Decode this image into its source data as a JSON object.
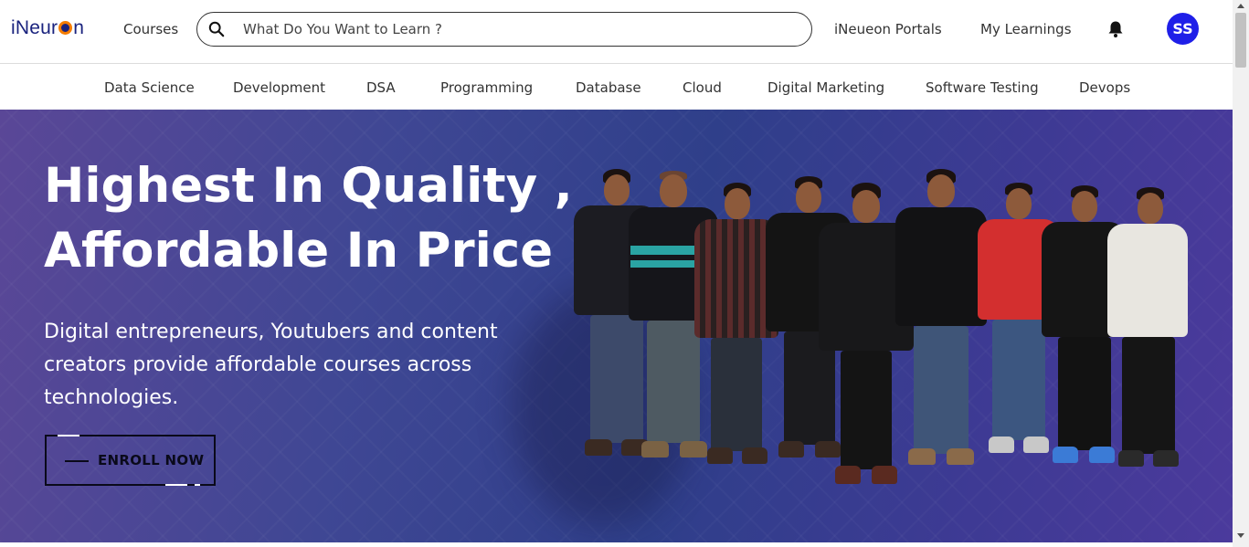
{
  "header": {
    "logo_text_1": "iNeur",
    "logo_text_2": "n",
    "courses_label": "Courses",
    "search": {
      "placeholder": "What Do You Want to Learn ?"
    },
    "portals_label": "iNeueon Portals",
    "learnings_label": "My Learnings",
    "avatar_initials": "SS"
  },
  "categories": [
    "Data Science",
    "Development",
    "DSA",
    "Programming",
    "Database",
    "Cloud",
    "Digital Marketing",
    "Software Testing",
    "Devops"
  ],
  "hero": {
    "title_line_1": "Highest In Quality ,",
    "title_line_2": "Affordable In Price",
    "subtitle": "Digital entrepreneurs, Youtubers and content creators provide affordable courses across technologies.",
    "enroll_label": "ENROLL NOW"
  },
  "colors": {
    "brand": "#1a237e",
    "accent": "#f57c00",
    "avatar_bg": "#1f1fe8",
    "hero_bg": "#3f4794"
  },
  "icons": {
    "search": "search-icon",
    "bell": "bell-icon"
  }
}
